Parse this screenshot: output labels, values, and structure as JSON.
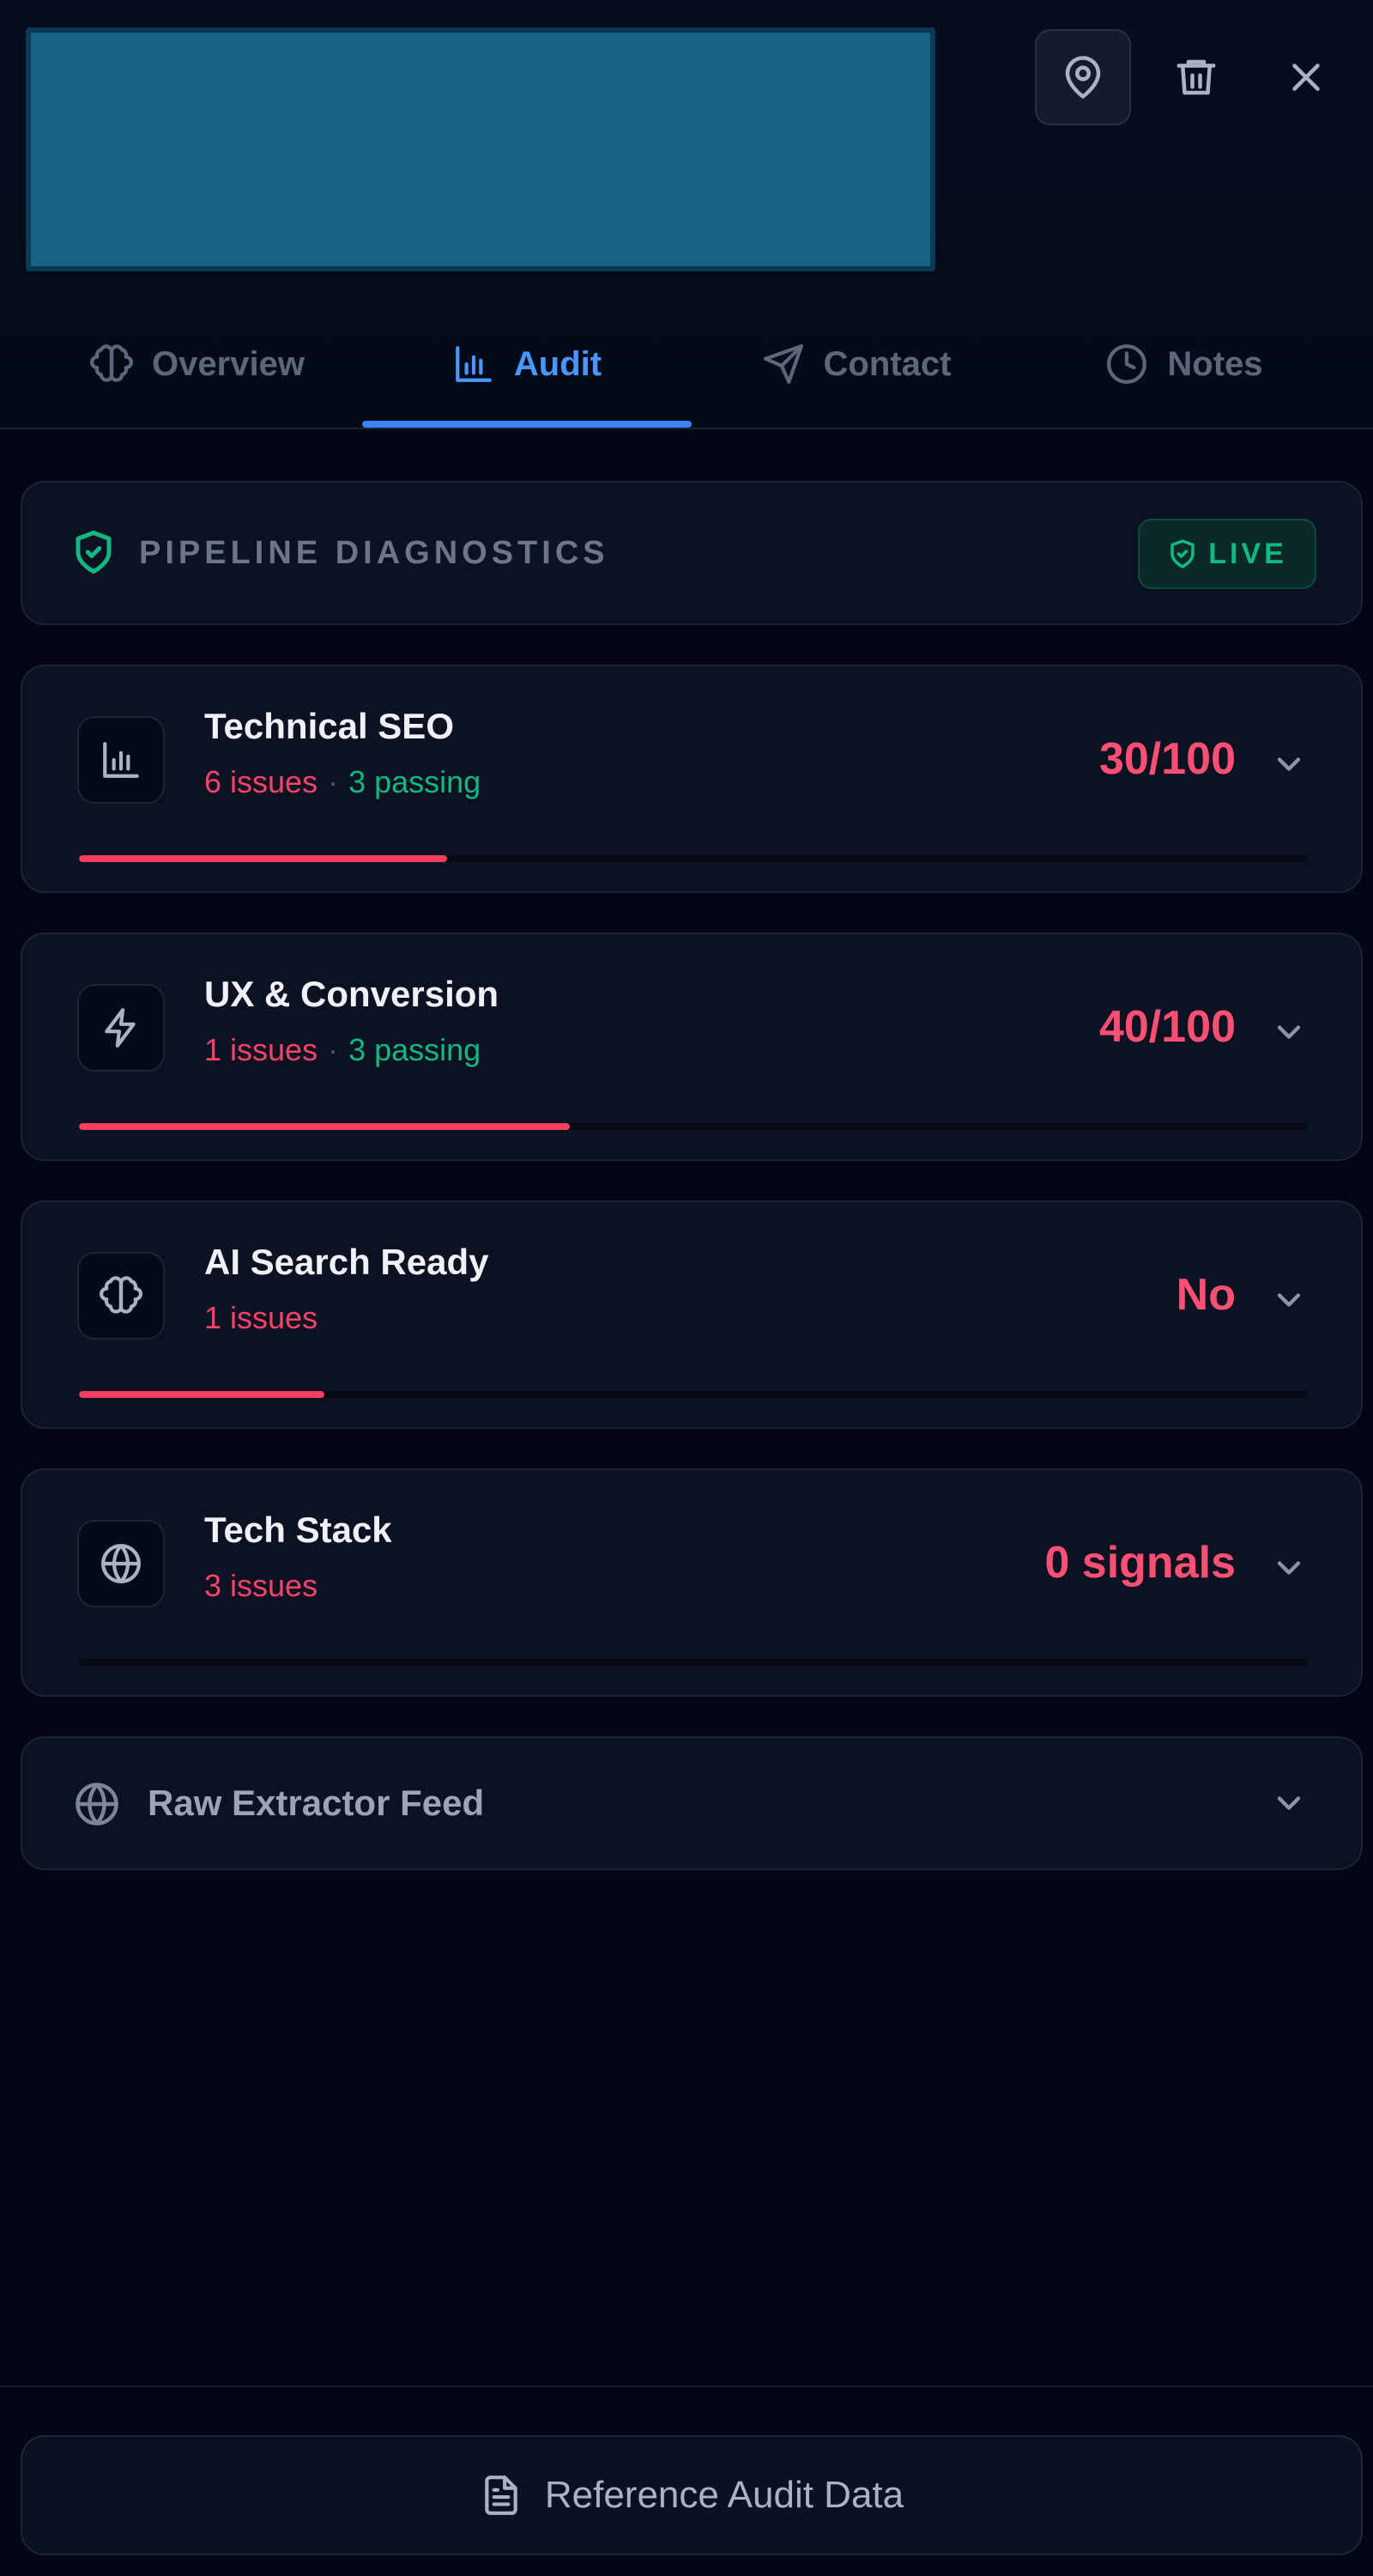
{
  "tabs": [
    {
      "label": "Overview",
      "icon": "brain-icon"
    },
    {
      "label": "Audit",
      "icon": "bar-chart-icon"
    },
    {
      "label": "Contact",
      "icon": "send-icon"
    },
    {
      "label": "Notes",
      "icon": "clock-icon"
    }
  ],
  "active_tab": "Audit",
  "diagnostics": {
    "title": "PIPELINE DIAGNOSTICS",
    "badge": "LIVE"
  },
  "metrics": [
    {
      "title": "Technical SEO",
      "issues": "6 issues",
      "passing": "3 passing",
      "score": "30/100",
      "progress": 0.3,
      "icon": "bar-chart-icon"
    },
    {
      "title": "UX & Conversion",
      "issues": "1 issues",
      "passing": "3 passing",
      "score": "40/100",
      "progress": 0.4,
      "icon": "lightning-icon"
    },
    {
      "title": "AI Search Ready",
      "issues": "1 issues",
      "passing": "",
      "score": "No",
      "progress": 0.2,
      "icon": "brain-icon"
    },
    {
      "title": "Tech Stack",
      "issues": "3 issues",
      "passing": "",
      "score": "0 signals",
      "progress": 0.0,
      "icon": "globe-icon"
    }
  ],
  "raw_feed": {
    "title": "Raw Extractor Feed"
  },
  "footer": {
    "button_label": "Reference Audit Data"
  },
  "colors": {
    "accent": "#3b82f6",
    "danger": "#f43f5e",
    "success": "#10b981",
    "background": "#030715"
  }
}
